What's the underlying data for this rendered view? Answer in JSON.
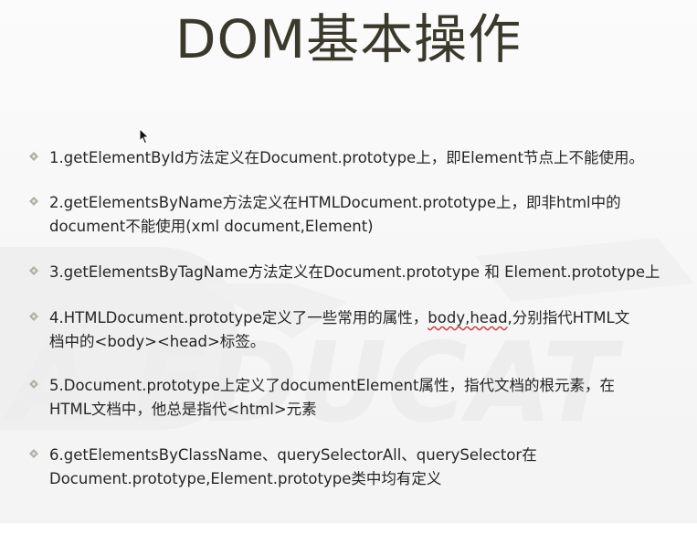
{
  "slide": {
    "title": "DOM基本操作",
    "watermark_text": "A EDUCAT",
    "bullets": [
      {
        "line1": "1.getElementById方法定义在Document.prototype上，即Element节点上不能使用。",
        "line2": ""
      },
      {
        "line1": "2.getElementsByName方法定义在HTMLDocument.prototype上，即非html中的",
        "line2": "document不能使用(xml document,Element)"
      },
      {
        "line1": "3.getElementsByTagName方法定义在Document.prototype 和 Element.prototype上",
        "line2": ""
      },
      {
        "line1_a": "4.HTMLDocument.prototype定义了一些常用的属性，",
        "line1_b": "body,head",
        "line1_c": ",分别指代HTML文",
        "line2": "档中的<body><head>标签。"
      },
      {
        "line1": "5.Document.prototype上定义了documentElement属性，指代文档的根元素，在",
        "line2": "HTML文档中，他总是指代<html>元素"
      },
      {
        "line1": "6.getElementsByClassName、querySelectorAll、querySelector在",
        "line2": "Document.prototype,Element.prototype类中均有定义"
      }
    ]
  },
  "colors": {
    "title": "#3b392c",
    "text": "#262626",
    "bullet_marker": "#b0b0a6",
    "watermark": "#eeeeee"
  },
  "icons": {
    "bullet": "diamond-bullet-icon",
    "cursor": "mouse-pointer-icon"
  }
}
